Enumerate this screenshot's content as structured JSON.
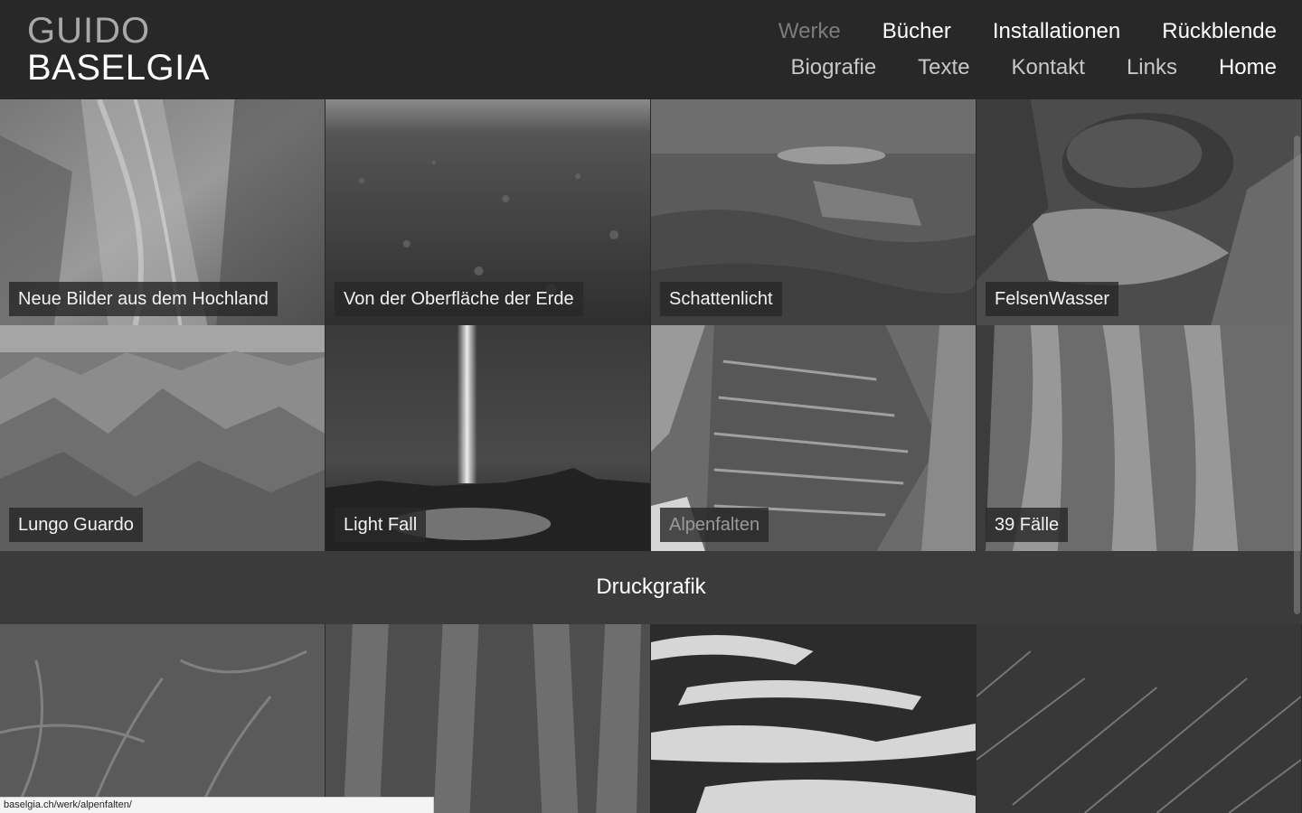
{
  "logo": {
    "first": "GUIDO",
    "last": "BASELGIA"
  },
  "nav": {
    "row1": [
      {
        "label": "Werke",
        "state": "active"
      },
      {
        "label": "Bücher"
      },
      {
        "label": "Installationen"
      },
      {
        "label": "Rückblende"
      }
    ],
    "row2": [
      {
        "label": "Biografie"
      },
      {
        "label": "Texte"
      },
      {
        "label": "Kontakt"
      },
      {
        "label": "Links"
      },
      {
        "label": "Home"
      }
    ]
  },
  "works": [
    {
      "title": "Neue Bilder aus dem Hochland",
      "image": "glacier-texture"
    },
    {
      "title": "Von der Oberfläche der Erde",
      "image": "gravel-plain"
    },
    {
      "title": "Schattenlicht",
      "image": "moss-pond"
    },
    {
      "title": "FelsenWasser",
      "image": "boulder-pool"
    },
    {
      "title": "Lungo Guardo",
      "image": "mountain-range"
    },
    {
      "title": "Light Fall",
      "image": "light-beam-lake"
    },
    {
      "title": "Alpenfalten",
      "image": "rock-face",
      "hovered": true
    },
    {
      "title": "39 Fälle",
      "image": "waterfall"
    }
  ],
  "section": {
    "title": "Druckgrafik"
  },
  "prints": [
    {
      "image": "plant-texture"
    },
    {
      "image": "eroded-relief"
    },
    {
      "image": "snow-patches"
    },
    {
      "image": "streak-texture"
    }
  ],
  "status": {
    "url": "baselgia.ch/werk/alpenfalten/"
  },
  "colors": {
    "header_bg": "#282828",
    "page_bg": "#333333",
    "active_nav": "#7c7c7c"
  }
}
